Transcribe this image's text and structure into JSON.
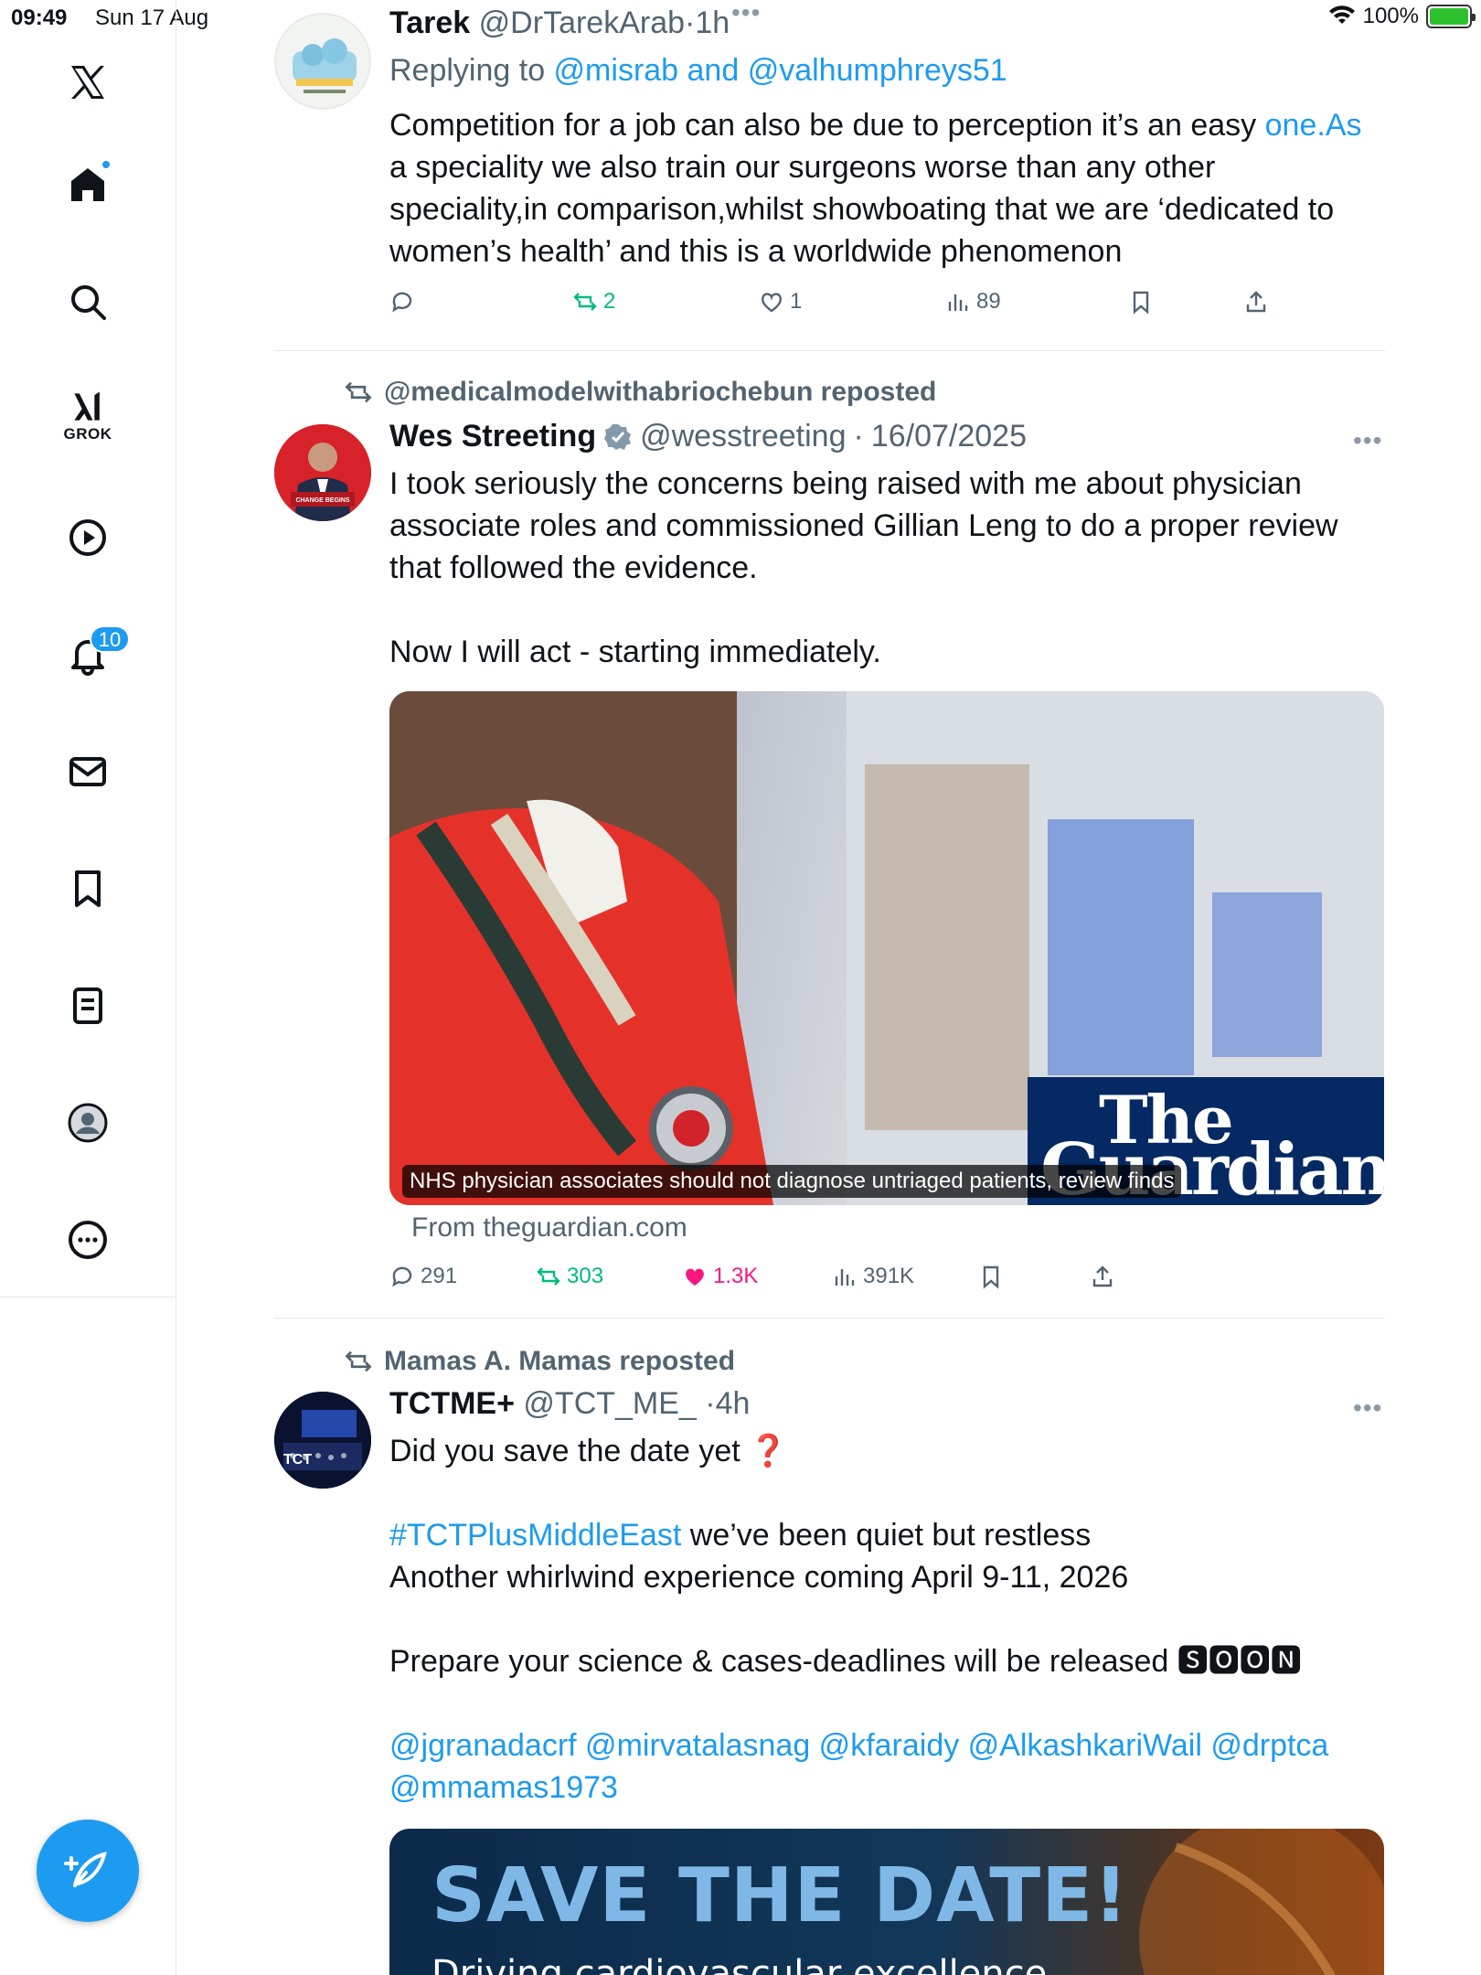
{
  "status_bar": {
    "time": "09:49",
    "date": "Sun 17 Aug",
    "battery": "100%"
  },
  "sidebar": {
    "items": [
      {
        "name": "x-logo"
      },
      {
        "name": "home"
      },
      {
        "name": "search"
      },
      {
        "name": "grok",
        "label": "GROK"
      },
      {
        "name": "video"
      },
      {
        "name": "notifications",
        "badge": "10"
      },
      {
        "name": "messages"
      },
      {
        "name": "bookmarks"
      },
      {
        "name": "lists"
      },
      {
        "name": "profile"
      },
      {
        "name": "more"
      }
    ]
  },
  "tweets": [
    {
      "name": "Tarek",
      "handle": "@DrTarekArab",
      "time": "1h",
      "replying_prefix": "Replying to ",
      "replying_to": "@misrab and @valhumphreys51",
      "body_lines": [
        "Competition for a job can also be due to perception it’s an easy ",
        "one.As",
        "a speciality we also train our surgeons worse than any other",
        "speciality,in comparison,whilst showboating that we are ‘dedicated to",
        "women’s health’ and this is a worldwide phenomenon"
      ],
      "reposts": "2",
      "likes": "1",
      "views": "89"
    },
    {
      "reposted_by": "@medicalmodelwithabriochebun reposted",
      "name": "Wes Streeting",
      "handle": "@wesstreeting",
      "time": "16/07/2025",
      "body_lines": [
        "I took seriously the concerns being raised with me about physician",
        "associate roles and commissioned Gillian Leng to do a proper review",
        "that followed the evidence.",
        "Now I will act - starting immediately."
      ],
      "card_caption": "NHS physician associates should not diagnose untriaged patients, review finds",
      "card_logo_line1": "The",
      "card_logo_line2": "Guardian",
      "card_source": "From theguardian.com",
      "replies": "291",
      "reposts": "303",
      "likes": "1.3K",
      "views": "391K"
    },
    {
      "reposted_by": "Mamas A. Mamas reposted",
      "name": "TCTME+",
      "handle": "@TCT_ME_",
      "time": "4h",
      "line1": "Did you save the date yet ",
      "line1_emoji": "❓",
      "hashtag": "#TCTPlusMiddleEast",
      "line2_rest": " we’ve been quiet but restless",
      "line3": "Another whirlwind experience coming April 9-11, 2026",
      "line4": "Prepare your science & cases-deadlines will be released 🆂🅾🅾🅽",
      "mentions1": "@jgranadacrf @mirvatalasnag @kfaraidy @AlkashkariWail @drptca",
      "mentions2": "@mmamas1973",
      "image_title": "SAVE THE DATE!",
      "image_subtitle": "Driving cardiovascular excellence",
      "avatar_text": "TCT"
    }
  ]
}
